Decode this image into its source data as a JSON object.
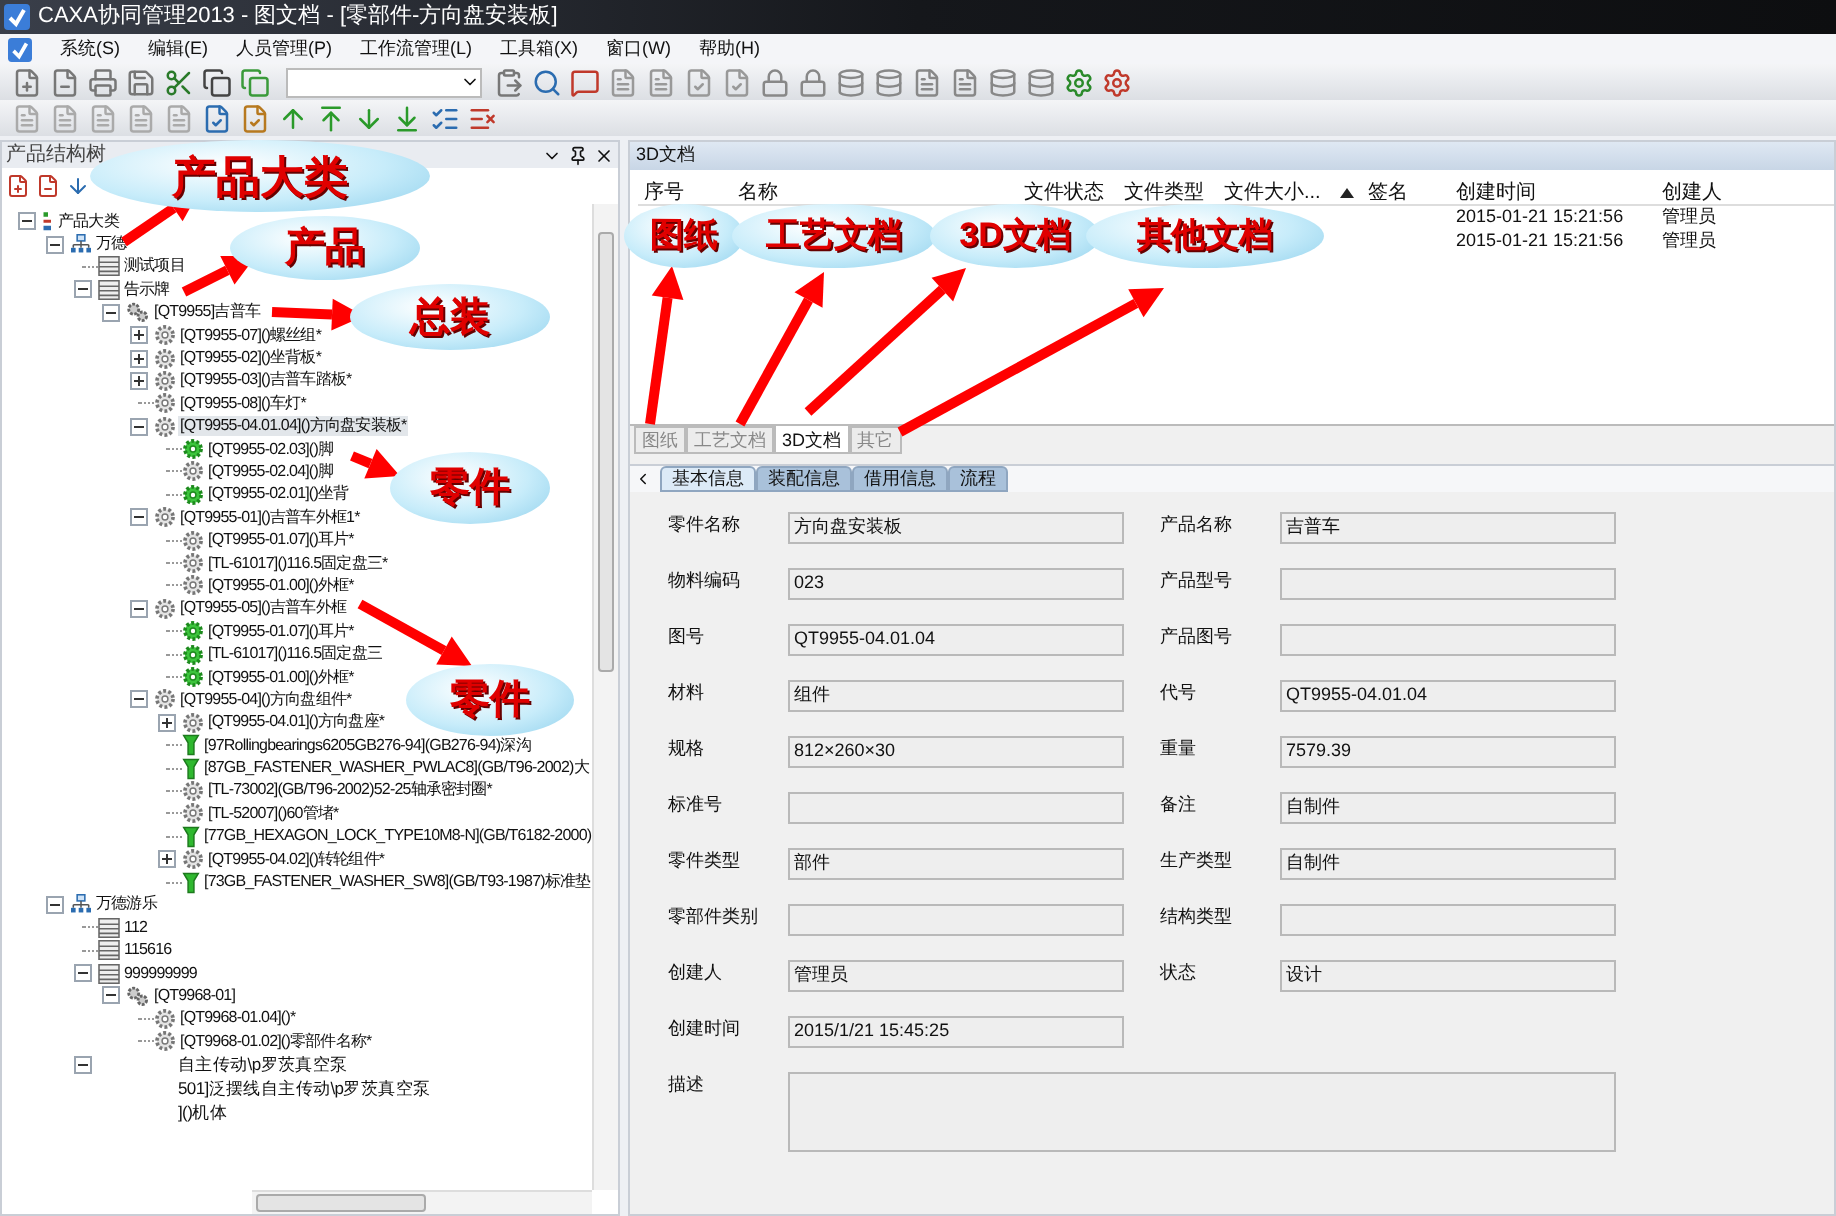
{
  "window": {
    "title": "CAXA协同管理2013 - 图文档 - [零部件-方向盘安装板]"
  },
  "menu": [
    "系统(S)",
    "编辑(E)",
    "人员管理(P)",
    "工作流管理(L)",
    "工具箱(X)",
    "窗口(W)",
    "帮助(H)"
  ],
  "left_panel": {
    "title": "产品结构树"
  },
  "tree": {
    "label": "产品大类",
    "kind": "root",
    "expanded": true,
    "selected": false,
    "children": [
      {
        "label": "万德",
        "kind": "company",
        "expanded": true,
        "selected": false,
        "children": [
          {
            "label": "测试项目",
            "kind": "project",
            "selected": false
          },
          {
            "label": "告示牌",
            "kind": "project",
            "expanded": true,
            "selected": false,
            "children": [
              {
                "label": "[QT9955]吉普车",
                "kind": "assembly",
                "expanded": true,
                "selected": false,
                "children": [
                  {
                    "label": "[QT9955-07]()螺丝组*",
                    "kind": "part",
                    "expanded": false,
                    "selected": false
                  },
                  {
                    "label": "[QT9955-02]()坐背板*",
                    "kind": "part",
                    "expanded": false,
                    "selected": false
                  },
                  {
                    "label": "[QT9955-03]()吉普车踏板*",
                    "kind": "part",
                    "expanded": false,
                    "selected": false
                  },
                  {
                    "label": "[QT9955-08]()车灯*",
                    "kind": "part",
                    "selected": false
                  },
                  {
                    "label": "[QT9955-04.01.04]()方向盘安装板*",
                    "kind": "part",
                    "expanded": true,
                    "selected": true,
                    "children": [
                      {
                        "label": "[QT9955-02.03]()脚",
                        "kind": "part-green",
                        "selected": false
                      },
                      {
                        "label": "[QT9955-02.04]()脚",
                        "kind": "part",
                        "selected": false
                      },
                      {
                        "label": "[QT9955-02.01]()坐背",
                        "kind": "part-green",
                        "selected": false
                      }
                    ]
                  },
                  {
                    "label": "[QT9955-01]()吉普车外框1*",
                    "kind": "part",
                    "expanded": true,
                    "selected": false,
                    "children": [
                      {
                        "label": "[QT9955-01.07]()耳片*",
                        "kind": "part",
                        "selected": false
                      },
                      {
                        "label": "[TL-61017]()116.5固定盘三*",
                        "kind": "part",
                        "selected": false
                      },
                      {
                        "label": "[QT9955-01.00]()外框*",
                        "kind": "part",
                        "selected": false
                      }
                    ]
                  },
                  {
                    "label": "[QT9955-05]()吉普车外框",
                    "kind": "part",
                    "expanded": true,
                    "selected": false,
                    "children": [
                      {
                        "label": "[QT9955-01.07]()耳片*",
                        "kind": "part-green",
                        "selected": false
                      },
                      {
                        "label": "[TL-61017]()116.5固定盘三",
                        "kind": "part-green",
                        "selected": false
                      },
                      {
                        "label": "[QT9955-01.00]()外框*",
                        "kind": "part-green",
                        "selected": false
                      }
                    ]
                  },
                  {
                    "label": "[QT9955-04]()方向盘组件*",
                    "kind": "part",
                    "expanded": true,
                    "selected": false,
                    "children": [
                      {
                        "label": "[QT9955-04.01]()方向盘座*",
                        "kind": "part",
                        "expanded": false,
                        "selected": false
                      },
                      {
                        "label": "[97Rollingbearings6205GB276-94](GB276-94)深沟",
                        "kind": "standard",
                        "selected": false
                      },
                      {
                        "label": "[87GB_FASTENER_WASHER_PWLAC8](GB/T96-2002)大",
                        "kind": "standard",
                        "selected": false
                      },
                      {
                        "label": "[TL-73002](GB/T96-2002)52-25轴承密封圈*",
                        "kind": "part",
                        "selected": false
                      },
                      {
                        "label": "[TL-52007]()60管堵*",
                        "kind": "part",
                        "selected": false
                      },
                      {
                        "label": "[77GB_HEXAGON_LOCK_TYPE10M8-N](GB/T6182-2000)",
                        "kind": "standard",
                        "selected": false
                      },
                      {
                        "label": "[QT9955-04.02]()转轮组件*",
                        "kind": "part",
                        "expanded": false,
                        "selected": false
                      },
                      {
                        "label": "[73GB_FASTENER_WASHER_SW8](GB/T93-1987)标准垫",
                        "kind": "standard",
                        "selected": false
                      }
                    ]
                  }
                ]
              }
            ]
          }
        ]
      },
      {
        "label": "万德游乐",
        "kind": "company",
        "expanded": true,
        "selected": false,
        "children": [
          {
            "label": "112",
            "kind": "project",
            "selected": false
          },
          {
            "label": "115616",
            "kind": "project",
            "selected": false
          },
          {
            "label": "999999999",
            "kind": "project",
            "expanded": true,
            "selected": false,
            "children": [
              {
                "label": "[QT9968-01]",
                "kind": "assembly",
                "expanded": true,
                "selected": false,
                "children": [
                  {
                    "label": "[QT9968-01.04]()*",
                    "kind": "part",
                    "selected": false
                  },
                  {
                    "label": "[QT9968-01.02]()零部件名称*",
                    "kind": "part",
                    "selected": false
                  }
                ]
              }
            ]
          }
        ]
      }
    ]
  },
  "partial_rows": [
    {
      "label": "自主传动\\p罗茨真空泵",
      "expanded": true
    },
    {
      "label": "501]泛摆线自主传动\\p罗茨真空泵"
    },
    {
      "label": "]()机体"
    }
  ],
  "documents": {
    "title": "3D文档",
    "columns": [
      {
        "label": "序号"
      },
      {
        "label": "名称"
      },
      {
        "label": "文件状态"
      },
      {
        "label": "文件类型"
      },
      {
        "label": "文件大小...",
        "sorted": true
      },
      {
        "label": "签名"
      },
      {
        "label": "创建时间"
      },
      {
        "label": "创建人"
      }
    ],
    "rows": [
      {
        "created": "2015-01-21 15:21:56",
        "creator": "管理员"
      },
      {
        "created": "2015-01-21 15:21:56",
        "creator": "管理员"
      }
    ],
    "tabs": [
      {
        "label": "图纸",
        "selected": false
      },
      {
        "label": "工艺文档",
        "selected": false
      },
      {
        "label": "3D文档",
        "selected": true
      },
      {
        "label": "其它",
        "selected": false
      }
    ]
  },
  "info_tabs": [
    {
      "label": "基本信息",
      "selected": true
    },
    {
      "label": "装配信息",
      "selected": false
    },
    {
      "label": "借用信息",
      "selected": false
    },
    {
      "label": "流程",
      "selected": false
    }
  ],
  "form": {
    "rows": [
      [
        {
          "label": "零件名称",
          "value": "方向盘安装板"
        },
        {
          "label": "产品名称",
          "value": "吉普车"
        }
      ],
      [
        {
          "label": "物料编码",
          "value": "023"
        },
        {
          "label": "产品型号"
        }
      ],
      [
        {
          "label": "图号",
          "value": "QT9955-04.01.04"
        },
        {
          "label": "产品图号"
        }
      ],
      [
        {
          "label": "材料",
          "value": "组件"
        },
        {
          "label": "代号",
          "value": "QT9955-04.01.04"
        }
      ],
      [
        {
          "label": "规格",
          "value": "812×260×30"
        },
        {
          "label": "重量",
          "value": "7579.39"
        }
      ],
      [
        {
          "label": "标准号"
        },
        {
          "label": "备注",
          "value": "自制件"
        }
      ],
      [
        {
          "label": "零件类型",
          "value": "部件"
        },
        {
          "label": "生产类型",
          "value": "自制件"
        }
      ],
      [
        {
          "label": "零部件类别"
        },
        {
          "label": "结构类型"
        }
      ],
      [
        {
          "label": "创建人",
          "value": "管理员"
        },
        {
          "label": "状态",
          "value": "设计"
        }
      ],
      [
        {
          "label": "创建时间",
          "value": "2015/1/21 15:45:25"
        }
      ]
    ],
    "description": {
      "label": "描述"
    }
  },
  "callouts": [
    {
      "text": "产品大类"
    },
    {
      "text": "产品"
    },
    {
      "text": "总装"
    },
    {
      "text": "零件"
    },
    {
      "text": "零件"
    },
    {
      "text": "图纸"
    },
    {
      "text": "工艺文档"
    },
    {
      "text": "3D文档"
    },
    {
      "text": "其他文档"
    }
  ]
}
